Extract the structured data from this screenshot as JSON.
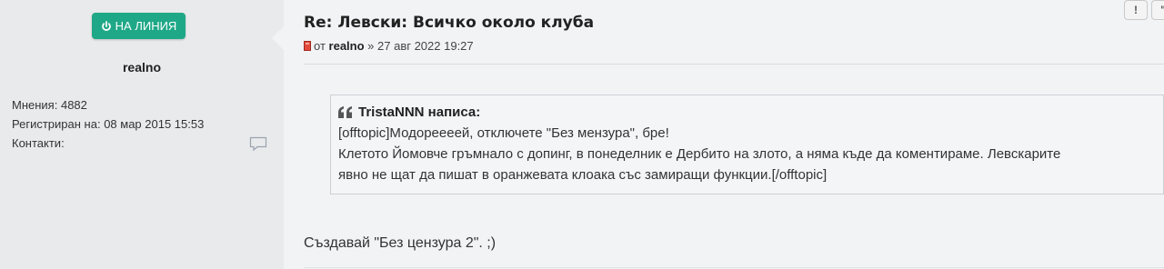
{
  "profile": {
    "online_label": "НА ЛИНИЯ",
    "username": "realno",
    "posts_label": "Мнения:",
    "posts_value": "4882",
    "registered_label": "Регистриран на:",
    "registered_value": "08 мар 2015 15:53",
    "contacts_label": "Контакти:"
  },
  "post": {
    "title": "Re: Левски: Всичко около клуба",
    "by_label": "от",
    "author": "realno",
    "date": "» 27 авг 2022 19:27",
    "report_label": "!",
    "quote_label": "\"",
    "quote": {
      "author_line": "TristaNNN написа:",
      "lines": [
        "[offtopic]Модореееей, отключете \"Без мензура\", бре!",
        "Клетото Йомовче гръмнало с допинг, в понеделник е Дербито на злото, а няма къде да коментираме. Левскарите",
        "явно не щат да пишат в оранжевата клоака със замиращи функции.[/offtopic]"
      ]
    },
    "body": "Създавай \"Без цензура 2\". ;)"
  },
  "colors": {
    "online": "#1fa887",
    "post_icon": "#c0392b"
  }
}
